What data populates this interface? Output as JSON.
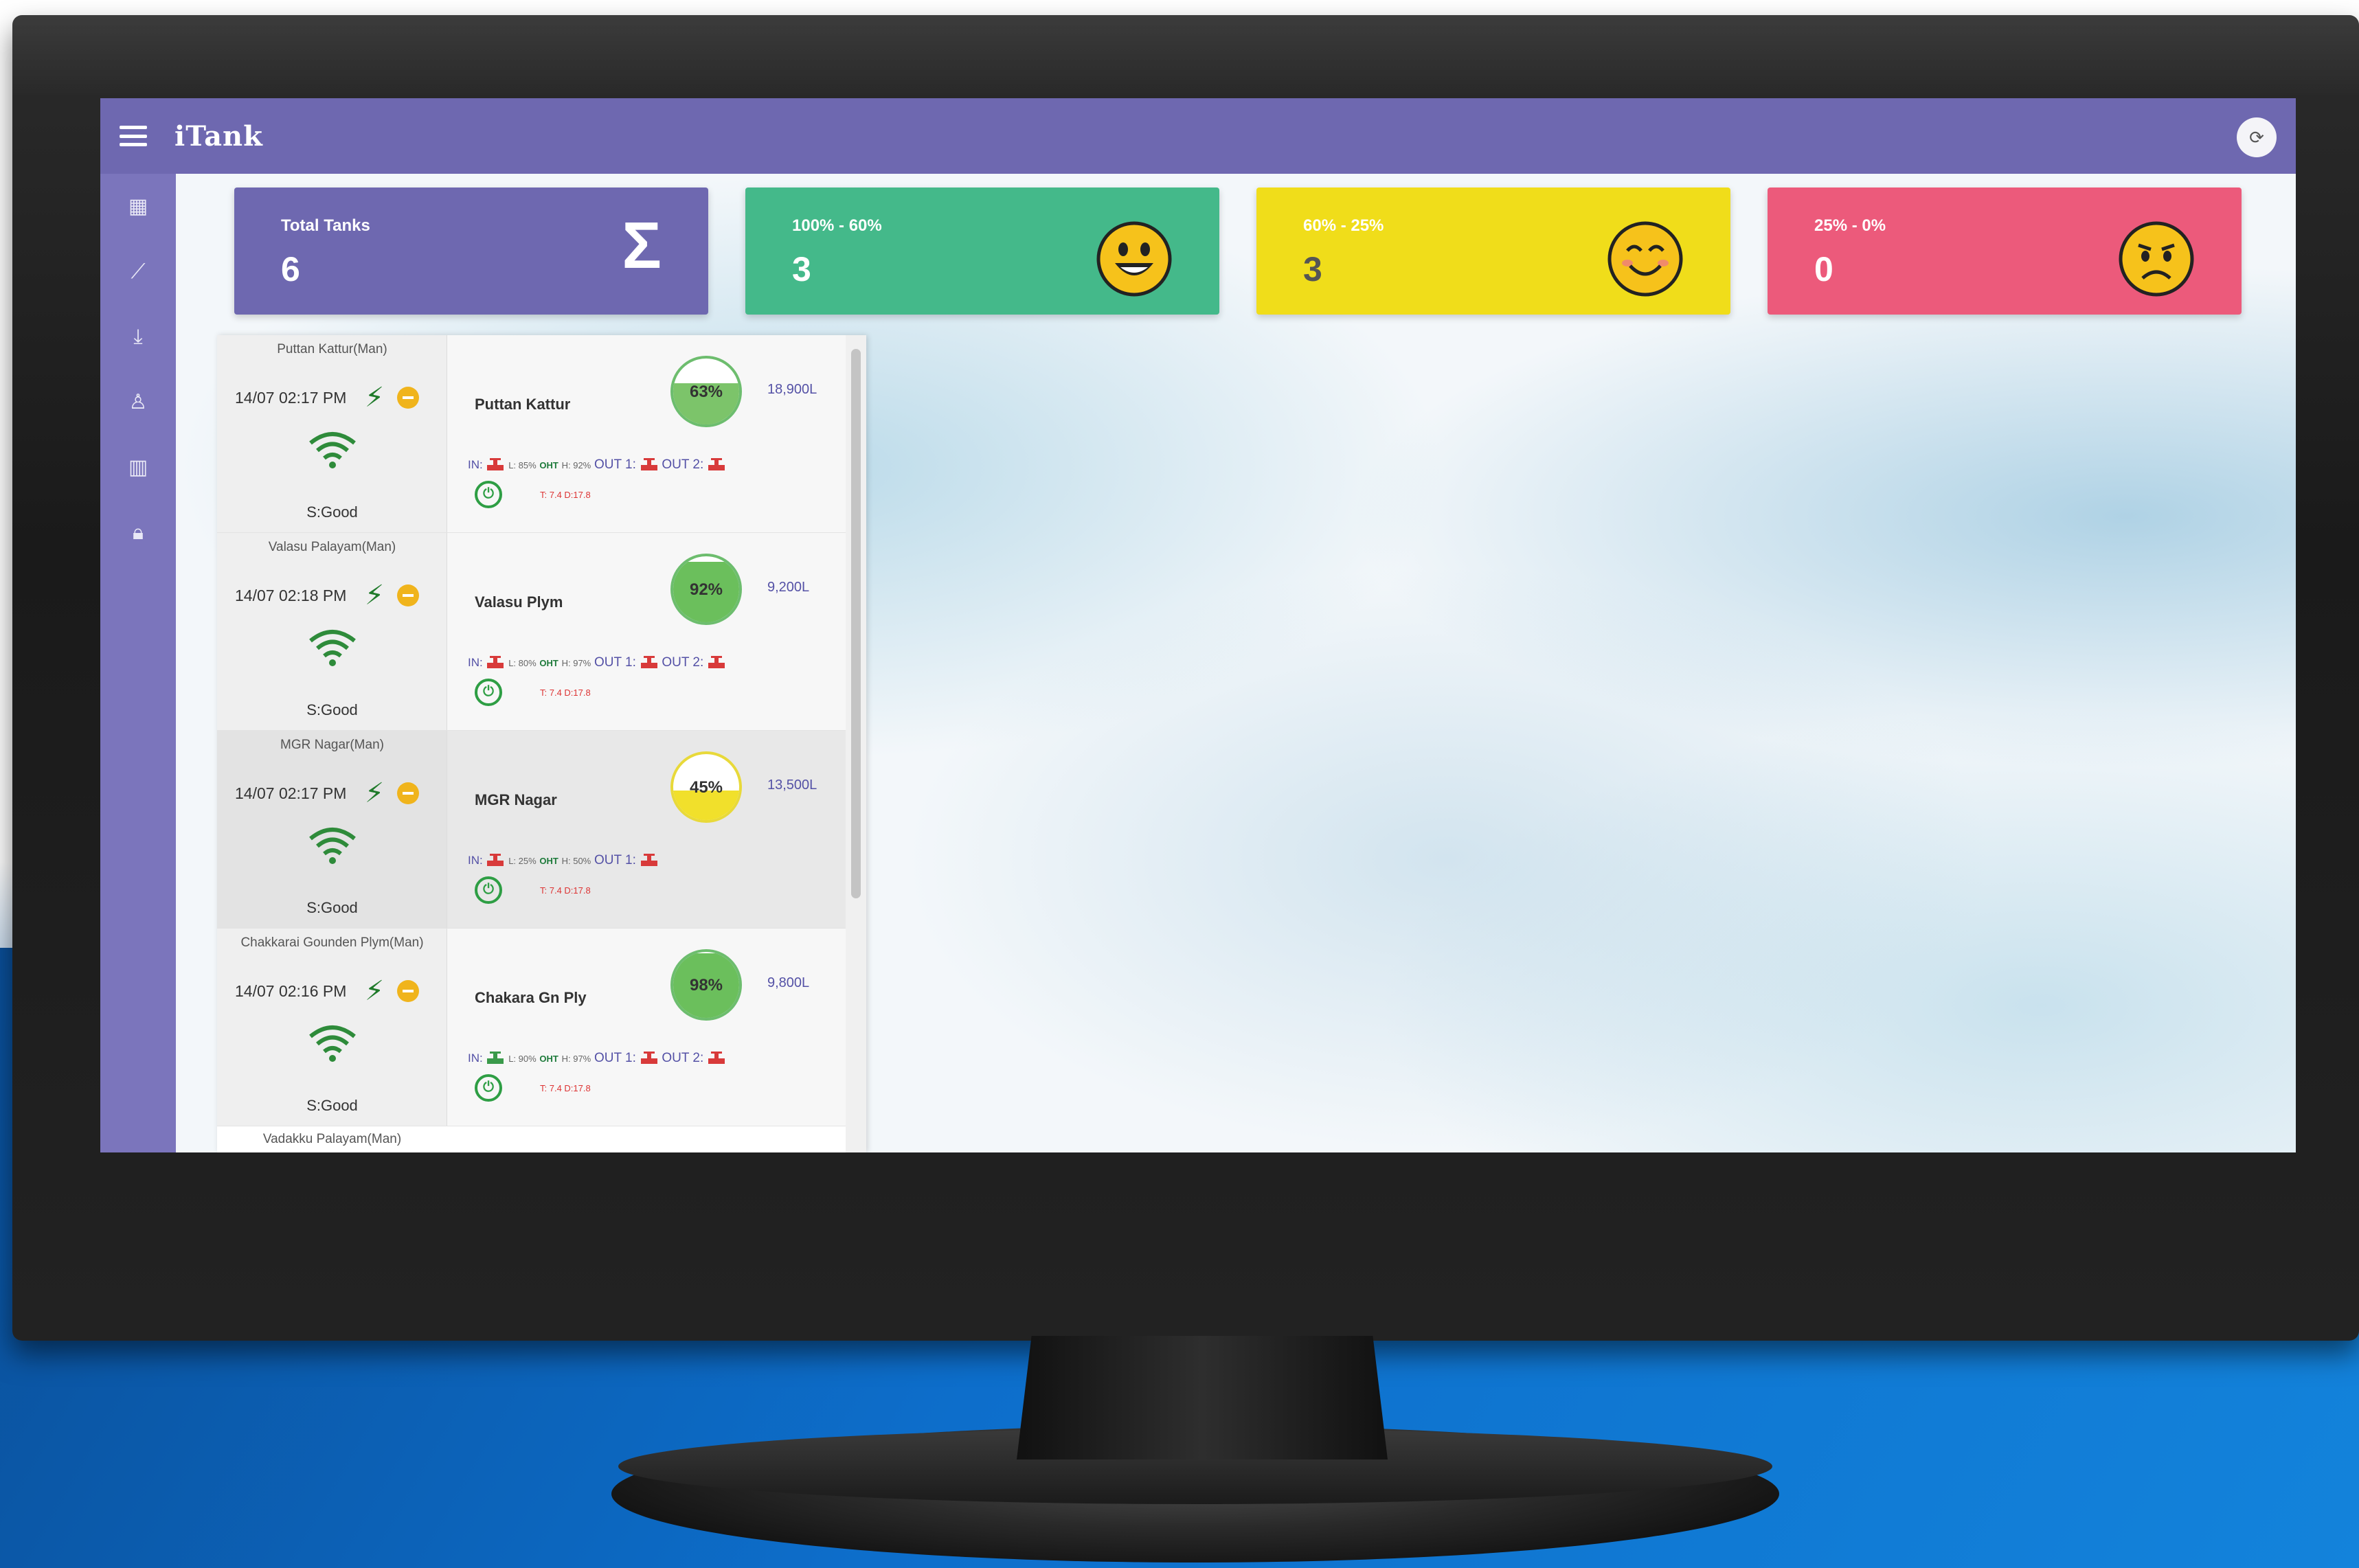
{
  "app": {
    "title": "iTank",
    "refresh_icon": "refresh-icon"
  },
  "sidebar": {
    "items": [
      {
        "icon": "grid-icon",
        "glyph": "▦"
      },
      {
        "icon": "trend-icon",
        "glyph": "⟋"
      },
      {
        "icon": "download-icon",
        "glyph": "⤓"
      },
      {
        "icon": "user-icon",
        "glyph": "♙"
      },
      {
        "icon": "map-icon",
        "glyph": "▥"
      },
      {
        "icon": "lock-icon",
        "glyph": "🔒︎"
      }
    ]
  },
  "stats": [
    {
      "label": "Total Tanks",
      "value": "6",
      "icon": "sigma-icon",
      "color": "#6e68b0"
    },
    {
      "label": "100% - 60%",
      "value": "3",
      "icon": "happy-face-icon",
      "color": "#44b98a"
    },
    {
      "label": "60% - 25%",
      "value": "3",
      "icon": "smile-face-icon",
      "color": "#f0dd1a"
    },
    {
      "label": "25% - 0%",
      "value": "0",
      "icon": "sad-face-icon",
      "color": "#ec5a7b"
    }
  ],
  "tanks": [
    {
      "site": "Puttan Kattur(Man)",
      "time": "14/07 02:17 PM",
      "signal": "S:Good",
      "name": "Puttan Kattur",
      "level": "63%",
      "level_value": 63,
      "capacity": "18,900L",
      "in": "IN:",
      "low": "L: 85%",
      "oht": "OHT",
      "high": "H: 92%",
      "out1": "OUT 1:",
      "out2": "OUT 2:",
      "temp": "T: 7.4 D:17.8",
      "fill_color": "#7cc46a"
    },
    {
      "site": "Valasu Palayam(Man)",
      "time": "14/07 02:18 PM",
      "signal": "S:Good",
      "name": "Valasu Plym",
      "level": "92%",
      "level_value": 92,
      "capacity": "9,200L",
      "in": "IN:",
      "low": "L: 80%",
      "oht": "OHT",
      "high": "H: 97%",
      "out1": "OUT 1:",
      "out2": "OUT 2:",
      "temp": "T: 7.4 D:17.8",
      "fill_color": "#6bbf5c"
    },
    {
      "site": "MGR Nagar(Man)",
      "time": "14/07 02:17 PM",
      "signal": "S:Good",
      "name": "MGR Nagar",
      "level": "45%",
      "level_value": 45,
      "capacity": "13,500L",
      "in": "IN:",
      "low": "L: 25%",
      "oht": "OHT",
      "high": "H: 50%",
      "out1": "OUT 1:",
      "out2": "",
      "temp": "T: 7.4 D:17.8",
      "fill_color": "#f1e02b"
    },
    {
      "site": "Chakkarai Gounden Plym(Man)",
      "time": "14/07 02:16 PM",
      "signal": "S:Good",
      "name": "Chakara Gn Ply",
      "level": "98%",
      "level_value": 98,
      "capacity": "9,800L",
      "in": "IN:",
      "low": "L: 90%",
      "oht": "OHT",
      "high": "H: 97%",
      "out1": "OUT 1:",
      "out2": "OUT 2:",
      "temp": "T: 7.4 D:17.8",
      "fill_color": "#6bbf5c"
    }
  ],
  "next_site": "Vadakku Palayam(Man)"
}
